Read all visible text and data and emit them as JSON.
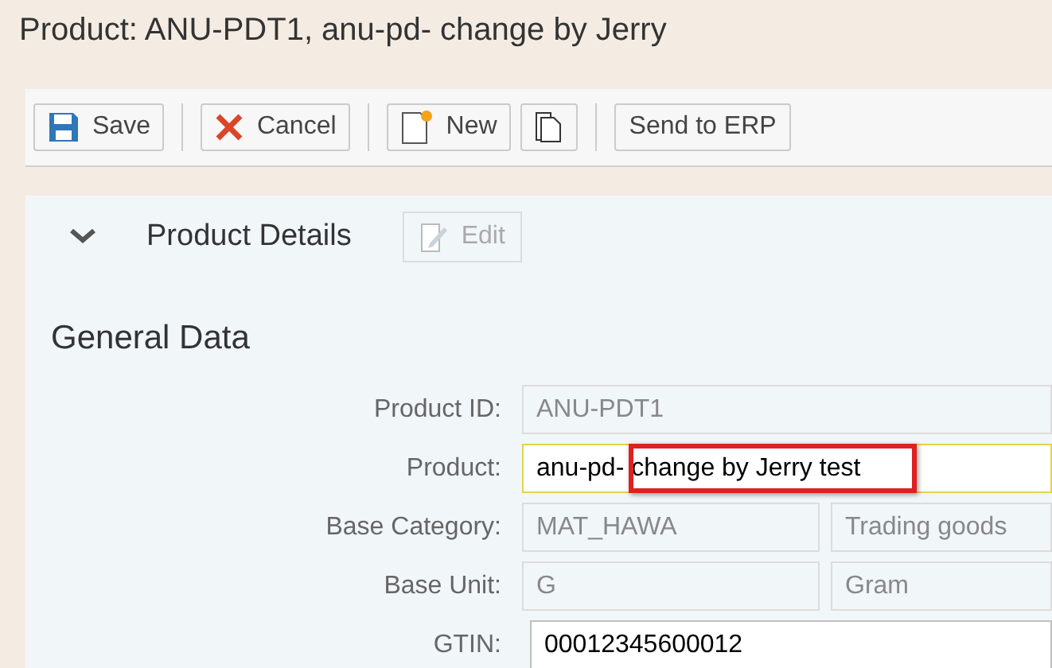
{
  "window": {
    "title": "Product: ANU-PDT1, anu-pd- change by Jerry"
  },
  "toolbar": [
    {
      "label": "Save",
      "kind": "save"
    },
    {
      "kind": "separator"
    },
    {
      "label": "Cancel",
      "kind": "cancel"
    },
    {
      "kind": "separator"
    },
    {
      "label": "New",
      "kind": "new"
    },
    {
      "kind": "copy"
    },
    {
      "kind": "separator"
    },
    {
      "label": "Send to ERP",
      "kind": "text"
    }
  ],
  "section": {
    "title": "Product Details",
    "expanded": true,
    "edit_button": {
      "label": "Edit",
      "disabled": true
    }
  },
  "form": {
    "title": "General Data",
    "fields": [
      {
        "label": "Product ID:",
        "values": [
          "ANU-PDT1"
        ],
        "editable": false
      },
      {
        "label": "Product:",
        "values": [
          "anu-pd- change by Jerry test"
        ],
        "editable": true,
        "focused": true,
        "highlighted": true
      },
      {
        "label": "Base Category:",
        "values": [
          "MAT_HAWA",
          "Trading goods"
        ],
        "editable": false
      },
      {
        "label": "Base Unit:",
        "values": [
          "G",
          "Gram"
        ],
        "editable": false
      },
      {
        "label": "GTIN:",
        "values": [
          "00012345600012"
        ],
        "editable": true,
        "focused": false
      }
    ]
  }
}
